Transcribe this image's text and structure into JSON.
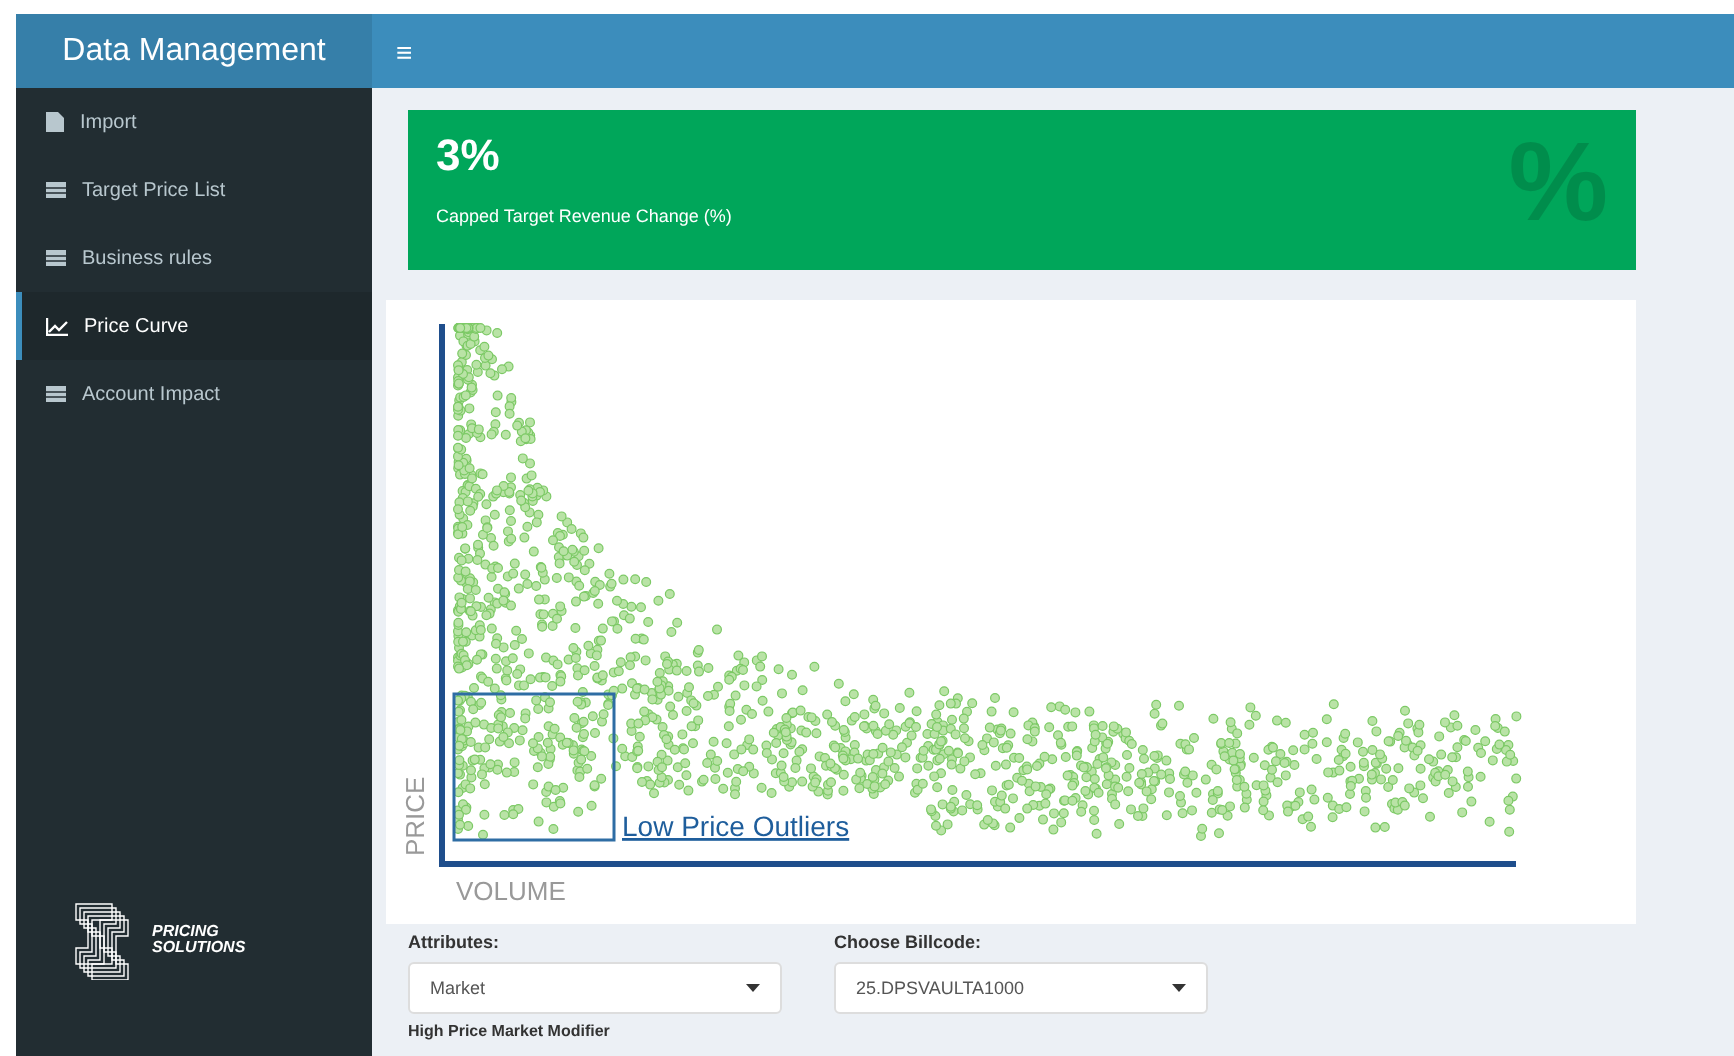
{
  "sidebar": {
    "title": "Data Management",
    "items": [
      {
        "label": "Import",
        "kind": "file",
        "selected": false
      },
      {
        "label": "Target Price List",
        "kind": "table",
        "selected": false
      },
      {
        "label": "Business rules",
        "kind": "table",
        "selected": false
      },
      {
        "label": "Price Curve",
        "kind": "chart",
        "selected": true
      },
      {
        "label": "Account Impact",
        "kind": "table",
        "selected": false
      }
    ],
    "logo": {
      "line_1": "PRICING",
      "line_2": "SOLUTIONS"
    }
  },
  "header": {
    "menu_toggle": "≡"
  },
  "info_box": {
    "value": "3%",
    "label": "Capped Target Revenue Change (%)",
    "icon": "%"
  },
  "scatter": {
    "ylabel": "PRICE",
    "xlabel": "VOLUME",
    "highlight_label": "Low Price Outliers"
  },
  "controls": [
    {
      "label": "Attributes:",
      "value": "Market"
    },
    {
      "label": "Choose Billcode:",
      "value": "25.DPSVAULTA1000"
    }
  ],
  "next_section": "High Price Market Modifier"
}
